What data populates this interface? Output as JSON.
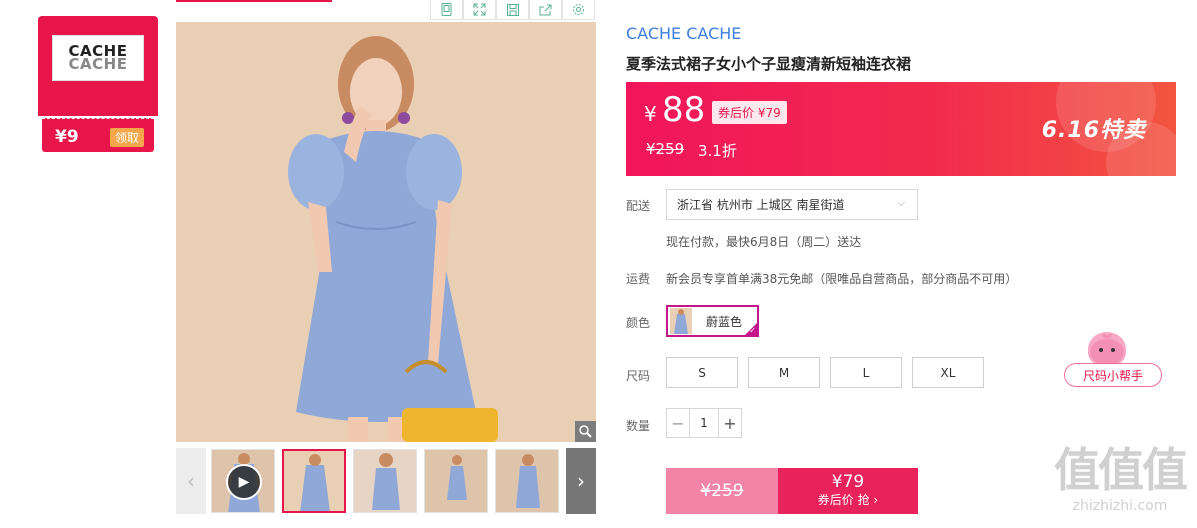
{
  "brand_card": {
    "logo_line1": "CACHE",
    "logo_line2": "CACHE",
    "coupon_price": "¥9",
    "claim_label": "领取"
  },
  "toolbar": {
    "icons": [
      "phone-icon",
      "fullscreen-icon",
      "save-icon",
      "share-icon",
      "settings-icon"
    ]
  },
  "gallery": {
    "zoom_icon": "magnifier-icon",
    "thumbnails": [
      "video",
      "image",
      "image",
      "image",
      "image"
    ],
    "active_index": 1
  },
  "product": {
    "brand": "CACHE CACHE",
    "title": "夏季法式裙子女小个子显瘦清新短袖连衣裙"
  },
  "price": {
    "currency": "¥",
    "value": "88",
    "coupon_tag": "券后价 ¥79",
    "original": "¥259",
    "discount": "3.1折",
    "sale_label": "6.16特卖"
  },
  "shipping": {
    "label": "配送",
    "location": "浙江省 杭州市 上城区 南星街道",
    "note": "现在付款，最快6月8日（周二）送达"
  },
  "freight": {
    "label": "运费",
    "text": "新会员专享首单满38元免邮（限唯品自营商品，部分商品不可用）"
  },
  "color": {
    "label": "颜色",
    "selected": "蔚蓝色"
  },
  "size": {
    "label": "尺码",
    "options": [
      "S",
      "M",
      "L",
      "XL"
    ],
    "helper": "尺码小帮手"
  },
  "quantity": {
    "label": "数量",
    "minus": "−",
    "value": "1",
    "plus": "+"
  },
  "buy": {
    "original": "¥259",
    "price": "¥79",
    "sub": "券后价 抢 ›"
  },
  "watermark": {
    "big": "值值值",
    "small": "zhizhizhi.com"
  },
  "colors": {
    "accent": "#e8154a",
    "brand_blue": "#3e7ee0",
    "select_purple": "#c4178b"
  }
}
